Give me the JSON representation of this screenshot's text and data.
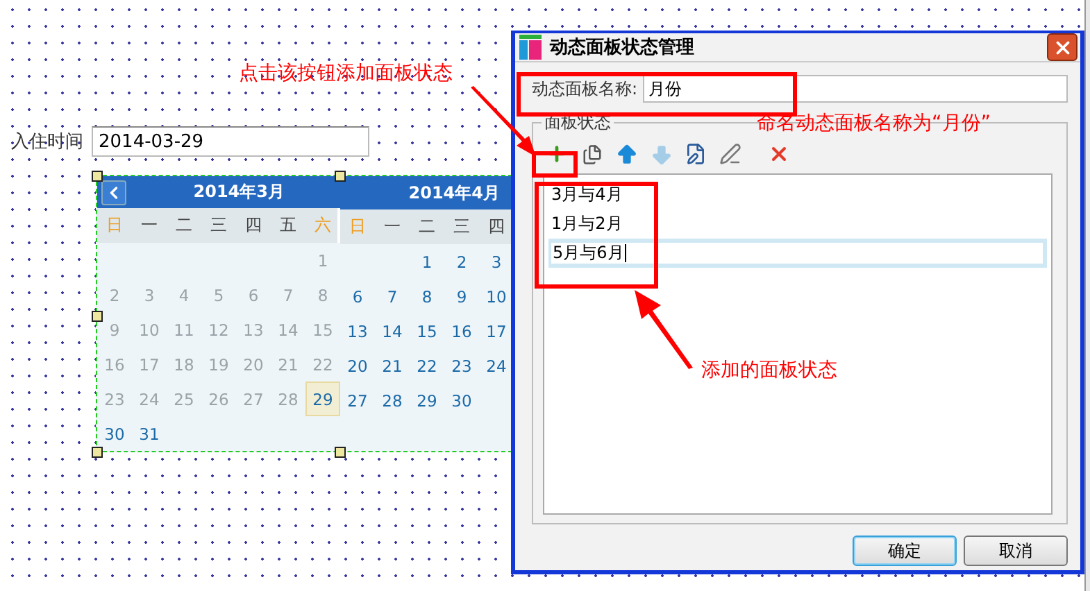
{
  "form_field": {
    "label": "入住时间",
    "value": "2014-03-29"
  },
  "calendar": {
    "months": [
      {
        "title": "2014年3月",
        "weekdays": [
          {
            "text": "日",
            "weekend": true
          },
          {
            "text": "一",
            "weekend": false
          },
          {
            "text": "二",
            "weekend": false
          },
          {
            "text": "三",
            "weekend": false
          },
          {
            "text": "四",
            "weekend": false
          },
          {
            "text": "五",
            "weekend": false
          },
          {
            "text": "六",
            "weekend": true
          }
        ],
        "weeks": [
          [
            {
              "kind": "empty"
            },
            {
              "kind": "empty"
            },
            {
              "kind": "empty"
            },
            {
              "kind": "empty"
            },
            {
              "kind": "empty"
            },
            {
              "kind": "empty"
            },
            {
              "kind": "day",
              "text": "1",
              "disabled": true,
              "selected": false
            }
          ],
          [
            {
              "kind": "day",
              "text": "2",
              "disabled": true,
              "selected": false
            },
            {
              "kind": "day",
              "text": "3",
              "disabled": true,
              "selected": false
            },
            {
              "kind": "day",
              "text": "4",
              "disabled": true,
              "selected": false
            },
            {
              "kind": "day",
              "text": "5",
              "disabled": true,
              "selected": false
            },
            {
              "kind": "day",
              "text": "6",
              "disabled": true,
              "selected": false
            },
            {
              "kind": "day",
              "text": "7",
              "disabled": true,
              "selected": false
            },
            {
              "kind": "day",
              "text": "8",
              "disabled": true,
              "selected": false
            }
          ],
          [
            {
              "kind": "day",
              "text": "9",
              "disabled": true,
              "selected": false
            },
            {
              "kind": "day",
              "text": "10",
              "disabled": true,
              "selected": false
            },
            {
              "kind": "day",
              "text": "11",
              "disabled": true,
              "selected": false
            },
            {
              "kind": "day",
              "text": "12",
              "disabled": true,
              "selected": false
            },
            {
              "kind": "day",
              "text": "13",
              "disabled": true,
              "selected": false
            },
            {
              "kind": "day",
              "text": "14",
              "disabled": true,
              "selected": false
            },
            {
              "kind": "day",
              "text": "15",
              "disabled": true,
              "selected": false
            }
          ],
          [
            {
              "kind": "day",
              "text": "16",
              "disabled": true,
              "selected": false
            },
            {
              "kind": "day",
              "text": "17",
              "disabled": true,
              "selected": false
            },
            {
              "kind": "day",
              "text": "18",
              "disabled": true,
              "selected": false
            },
            {
              "kind": "day",
              "text": "19",
              "disabled": true,
              "selected": false
            },
            {
              "kind": "day",
              "text": "20",
              "disabled": true,
              "selected": false
            },
            {
              "kind": "day",
              "text": "21",
              "disabled": true,
              "selected": false
            },
            {
              "kind": "day",
              "text": "22",
              "disabled": true,
              "selected": false
            }
          ],
          [
            {
              "kind": "day",
              "text": "23",
              "disabled": true,
              "selected": false
            },
            {
              "kind": "day",
              "text": "24",
              "disabled": true,
              "selected": false
            },
            {
              "kind": "day",
              "text": "25",
              "disabled": true,
              "selected": false
            },
            {
              "kind": "day",
              "text": "26",
              "disabled": true,
              "selected": false
            },
            {
              "kind": "day",
              "text": "27",
              "disabled": true,
              "selected": false
            },
            {
              "kind": "day",
              "text": "28",
              "disabled": true,
              "selected": false
            },
            {
              "kind": "day",
              "text": "29",
              "disabled": false,
              "selected": true
            }
          ],
          [
            {
              "kind": "day",
              "text": "30",
              "disabled": false,
              "selected": false
            },
            {
              "kind": "day",
              "text": "31",
              "disabled": false,
              "selected": false
            },
            {
              "kind": "empty"
            },
            {
              "kind": "empty"
            },
            {
              "kind": "empty"
            },
            {
              "kind": "empty"
            },
            {
              "kind": "empty"
            }
          ]
        ]
      },
      {
        "title": "2014年4月",
        "weekdays": [
          {
            "text": "日",
            "weekend": true
          },
          {
            "text": "一",
            "weekend": false
          },
          {
            "text": "二",
            "weekend": false
          },
          {
            "text": "三",
            "weekend": false
          },
          {
            "text": "四",
            "weekend": false
          }
        ],
        "weeks": [
          [
            {
              "kind": "empty"
            },
            {
              "kind": "empty"
            },
            {
              "kind": "day",
              "text": "1",
              "disabled": false,
              "selected": false
            },
            {
              "kind": "day",
              "text": "2",
              "disabled": false,
              "selected": false
            },
            {
              "kind": "day",
              "text": "3",
              "disabled": false,
              "selected": false
            }
          ],
          [
            {
              "kind": "day",
              "text": "6",
              "disabled": false,
              "selected": false
            },
            {
              "kind": "day",
              "text": "7",
              "disabled": false,
              "selected": false
            },
            {
              "kind": "day",
              "text": "8",
              "disabled": false,
              "selected": false
            },
            {
              "kind": "day",
              "text": "9",
              "disabled": false,
              "selected": false
            },
            {
              "kind": "day",
              "text": "10",
              "disabled": false,
              "selected": false
            }
          ],
          [
            {
              "kind": "day",
              "text": "13",
              "disabled": false,
              "selected": false
            },
            {
              "kind": "day",
              "text": "14",
              "disabled": false,
              "selected": false
            },
            {
              "kind": "day",
              "text": "15",
              "disabled": false,
              "selected": false
            },
            {
              "kind": "day",
              "text": "16",
              "disabled": false,
              "selected": false
            },
            {
              "kind": "day",
              "text": "17",
              "disabled": false,
              "selected": false
            }
          ],
          [
            {
              "kind": "day",
              "text": "20",
              "disabled": false,
              "selected": false
            },
            {
              "kind": "day",
              "text": "21",
              "disabled": false,
              "selected": false
            },
            {
              "kind": "day",
              "text": "22",
              "disabled": false,
              "selected": false
            },
            {
              "kind": "day",
              "text": "23",
              "disabled": false,
              "selected": false
            },
            {
              "kind": "day",
              "text": "24",
              "disabled": false,
              "selected": false
            }
          ],
          [
            {
              "kind": "day",
              "text": "27",
              "disabled": false,
              "selected": false
            },
            {
              "kind": "day",
              "text": "28",
              "disabled": false,
              "selected": false
            },
            {
              "kind": "day",
              "text": "29",
              "disabled": false,
              "selected": false
            },
            {
              "kind": "day",
              "text": "30",
              "disabled": false,
              "selected": false
            },
            {
              "kind": "empty"
            }
          ]
        ]
      }
    ]
  },
  "dialog": {
    "title": "动态面板状态管理",
    "name_label": "动态面板名称:",
    "name_value": "月份",
    "group_label": "面板状态",
    "toolbar": [
      {
        "kind": "add",
        "disabled": false
      },
      {
        "kind": "copy",
        "disabled": false
      },
      {
        "kind": "up",
        "disabled": false
      },
      {
        "kind": "down",
        "disabled": true
      },
      {
        "kind": "edit",
        "disabled": false
      },
      {
        "kind": "edit-all",
        "disabled": false
      },
      {
        "kind": "delete",
        "disabled": false
      }
    ],
    "states": [
      {
        "text": "3月与4月",
        "selected": false
      },
      {
        "text": "1月与2月",
        "selected": false
      },
      {
        "text": "5月与6月",
        "selected": true
      }
    ],
    "buttons": [
      {
        "text": "确定",
        "focused": true
      },
      {
        "text": "取消",
        "focused": false
      }
    ]
  },
  "annotations": [
    {
      "text": "点击该按钮添加面板状态"
    },
    {
      "text": "命名动态面板名称为“月份”"
    },
    {
      "text": "添加的面板状态"
    }
  ]
}
